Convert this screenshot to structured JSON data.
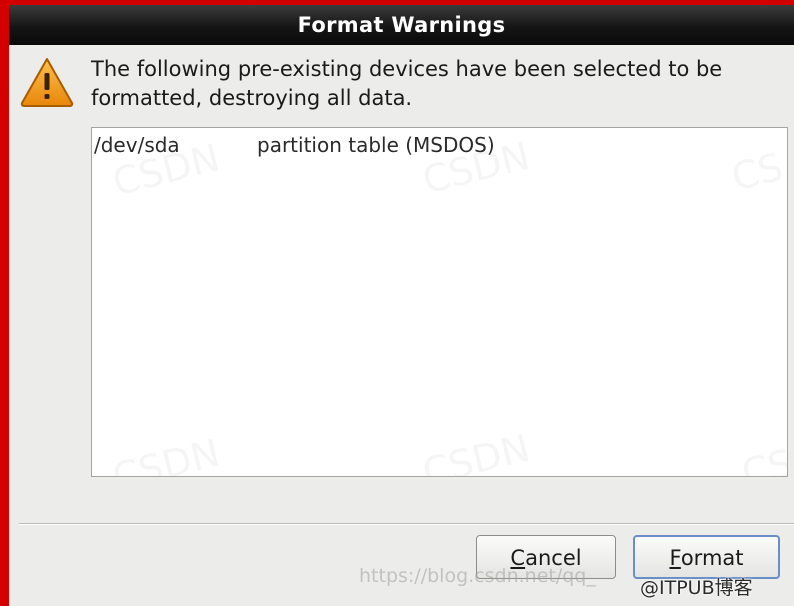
{
  "dialog": {
    "title": "Format Warnings",
    "message": "The following pre-existing devices have been selected to be formatted, destroying all data.",
    "icon": "warning-icon"
  },
  "devices": [
    {
      "name": "/dev/sda",
      "description": "partition table (MSDOS)"
    }
  ],
  "buttons": {
    "cancel": {
      "mnemonic": "C",
      "rest": "ancel"
    },
    "format": {
      "mnemonic": "F",
      "rest": "ormat"
    }
  },
  "watermarks": {
    "url": "https://blog.csdn.net/qq_",
    "author": "@ITPUB博客"
  },
  "colors": {
    "titlebar": "#151515",
    "dialog_bg": "#ececea",
    "frame": "#d40000",
    "warning": "#f3a21d"
  }
}
